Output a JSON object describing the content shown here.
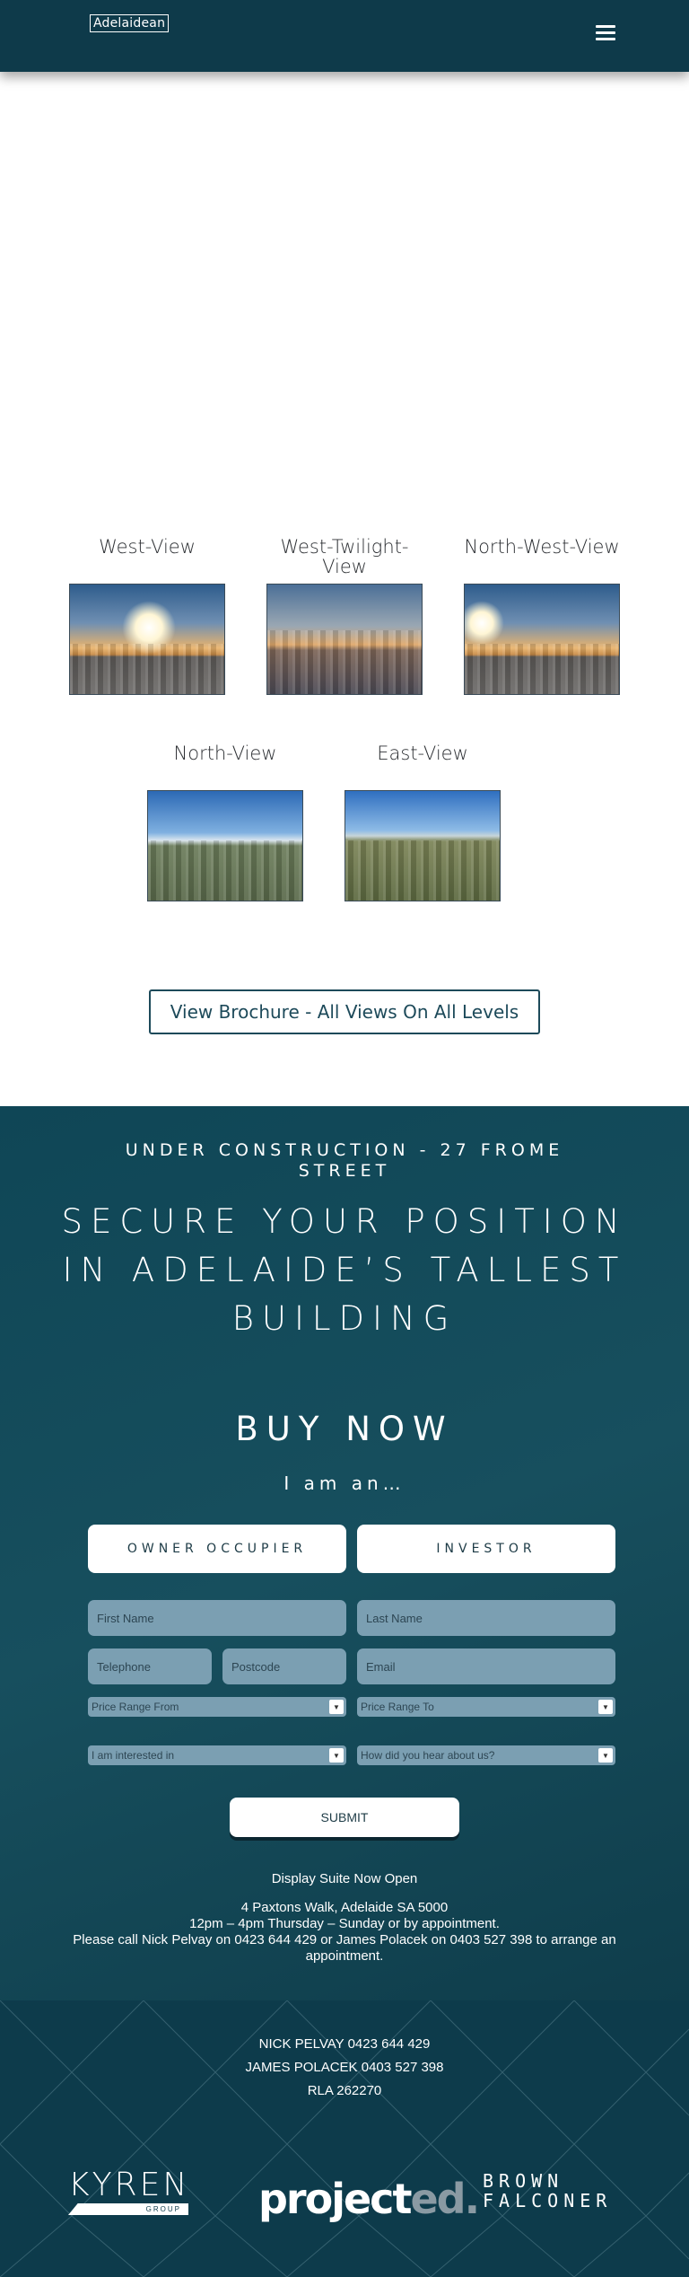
{
  "header": {
    "logo_text": "Adelaidean",
    "menu_icon": "hamburger-menu-icon"
  },
  "views": [
    {
      "title": "West-View"
    },
    {
      "title": "West-Twilight-View"
    },
    {
      "title": "North-West-View"
    },
    {
      "title": "North-View"
    },
    {
      "title": "East-View"
    }
  ],
  "brochure_button": "View Brochure - All Views On All Levels",
  "promo": {
    "under_construction": "UNDER CONSTRUCTION -  27 FROME STREET",
    "headline": "SECURE YOUR POSITION IN ADELAIDE’S TALLEST BUILDING",
    "buy_now": "BUY NOW",
    "i_am": "I am an…",
    "choices": [
      "OWNER OCCUPIER",
      "INVESTOR"
    ]
  },
  "form": {
    "first_name": "First Name",
    "last_name": "Last Name",
    "telephone": "Telephone",
    "postcode": "Postcode",
    "email": "Email",
    "price_from": "Price Range From",
    "price_to": "Price Range To",
    "interested": "I am interested in",
    "hear_about": "How did you hear about us?",
    "submit": "SUBMIT"
  },
  "display": {
    "heading": "Display Suite Now Open",
    "address": "4 Paxtons Walk, Adelaide SA 5000",
    "hours": "12pm – 4pm Thursday – Sunday or by appointment.",
    "call": "Please call Nick Pelvay on 0423 644 429 or James Polacek on 0403 527 398 to arrange an appointment."
  },
  "footer": {
    "contact1": "NICK PELVAY   0423 644 429",
    "contact2": "JAMES POLACEK   0403 527 398",
    "rla": "RLA 262270",
    "logo_kyren": "KYREN",
    "logo_kyren_sub": "GROUP",
    "logo_projected_main": "project",
    "logo_projected_suffix": "ed.",
    "logo_brown_line1": "BROWN",
    "logo_brown_line2": "FALCONER"
  },
  "colors": {
    "header_bg": "#0e3a4a",
    "promo_bg": "#174f5e",
    "footer_bg": "#0d3b4b",
    "field_bg": "#7b9fb2",
    "accent_text": "#1d4a5a"
  }
}
